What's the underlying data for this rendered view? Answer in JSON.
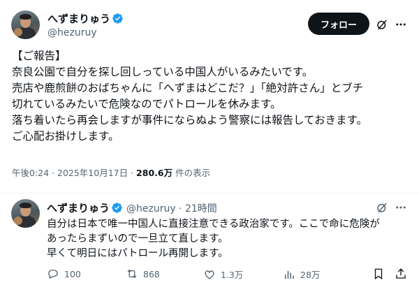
{
  "main_post": {
    "display_name": "へずまりゅう",
    "handle": "@hezuruy",
    "follow_label": "フォロー",
    "lines": [
      "【ご報告】",
      "奈良公園で自分を探し回しっている中国人がいるみたいです。",
      "売店や鹿煎餅のおばちゃんに「へずまはどこだ？」「絶対許さん」とブチ",
      "切れているみたいで危険なのでパトロールを休みます。",
      "落ち着いたら再会しますが事件にならぬよう警察には報告しておきます。",
      "ご心配お掛けします。"
    ],
    "timestamp": "午後0:24 · 2025年10月17日 · ",
    "views_count": "280.6万",
    "views_label": " 件の表示"
  },
  "reply_post": {
    "display_name": "へずまりゅう",
    "handle_time": "@hezuruy · 21時間",
    "lines": [
      "自分は日本で唯一中国人に直接注意できる政治家です。ここで命に危険が",
      "あったらまずいので一旦立て直します。",
      "早くて明日にはパトロール再開します。"
    ],
    "actions": {
      "replies": "100",
      "reposts": "868",
      "likes": "1.3万",
      "views": "28万"
    }
  },
  "icons": {
    "verified": "verified-badge-icon",
    "grok": "grok-icon",
    "more": "more-icon",
    "reply": "reply-icon",
    "repost": "repost-icon",
    "like": "like-icon",
    "views": "views-icon",
    "bookmark": "bookmark-icon",
    "share": "share-icon"
  },
  "colors": {
    "verified_blue": "#1d9bf0",
    "text": "#0f1419",
    "secondary": "#536471",
    "follow_bg": "#0f1419"
  }
}
